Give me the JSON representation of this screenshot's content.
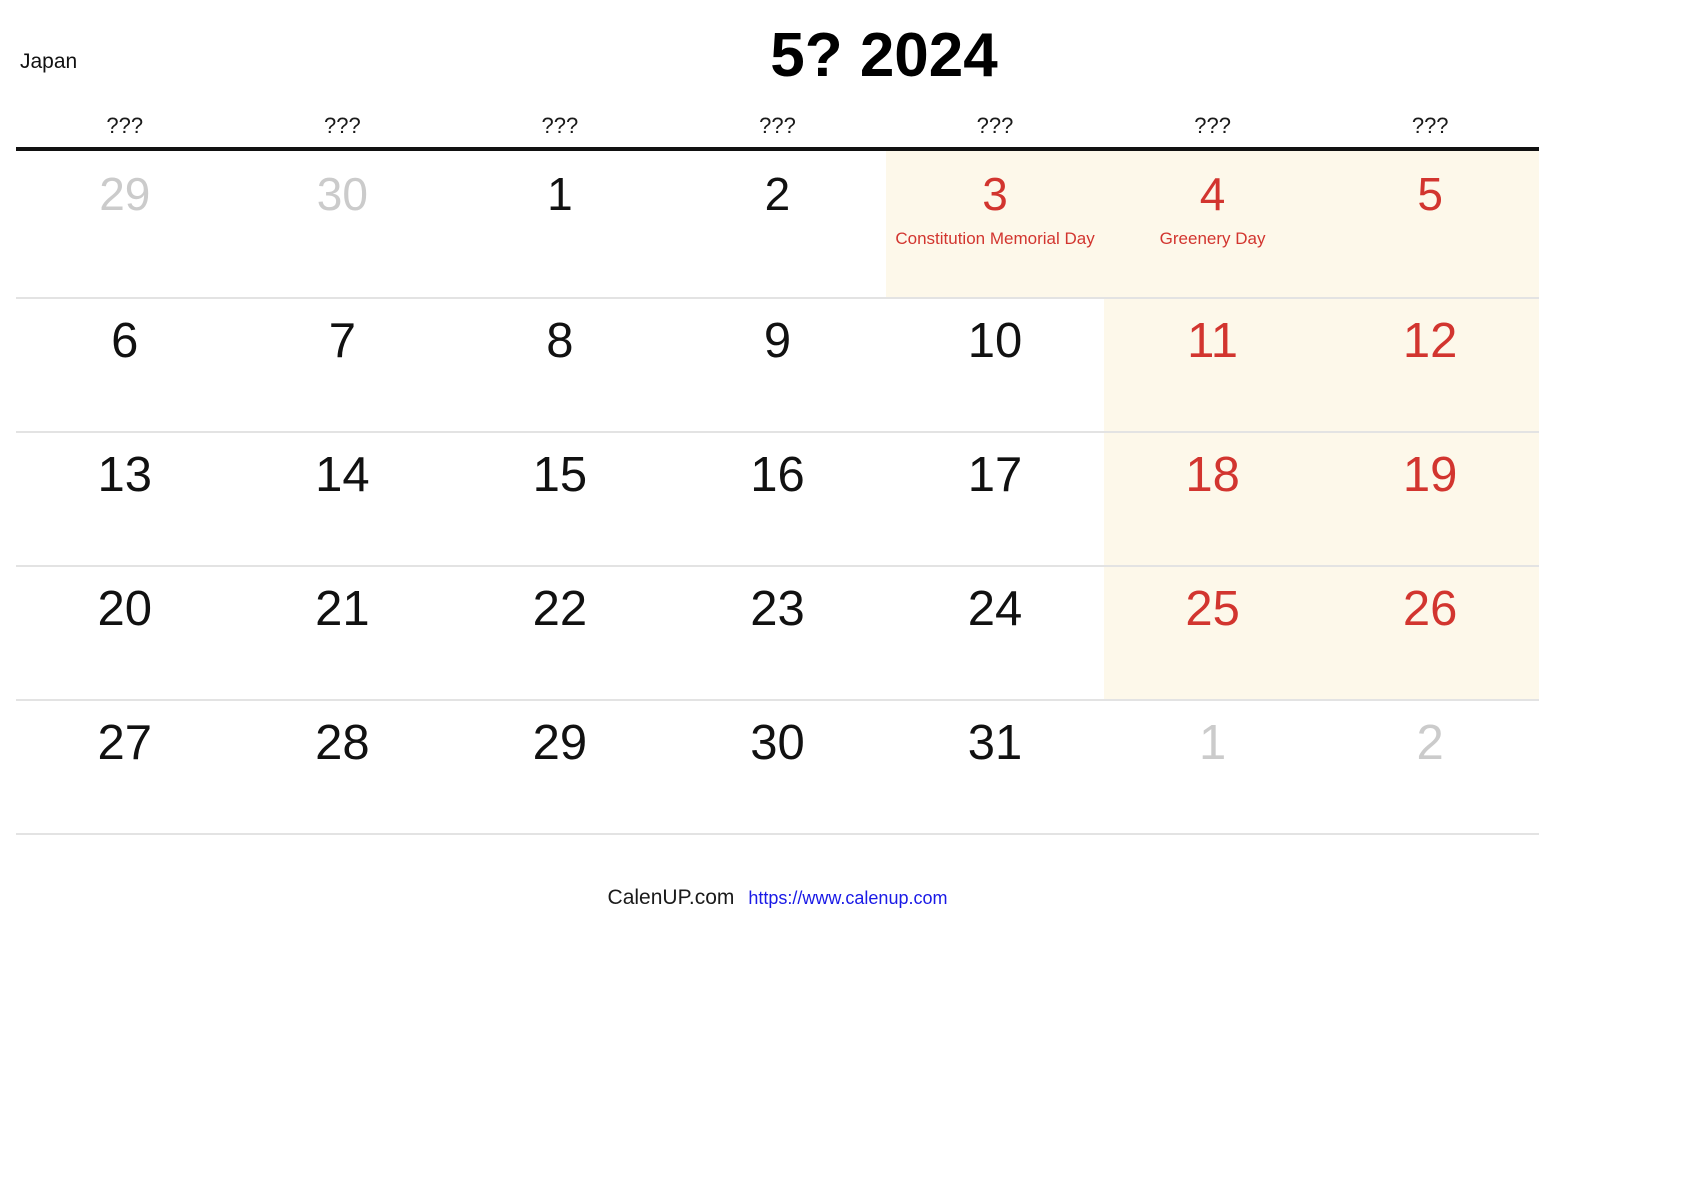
{
  "header": {
    "region_label": "Japan",
    "title": "5? 2024"
  },
  "weekday_headers": [
    "???",
    "???",
    "???",
    "???",
    "???",
    "???",
    "???"
  ],
  "colors": {
    "holiday_red": "#d2352f",
    "weekend_bg": "#fdf8ea",
    "muted_gray": "#cbcbcb",
    "link_blue": "#1919e6",
    "rule_black": "#111111",
    "row_divider": "#e3e3e3"
  },
  "weeks": [
    {
      "days": [
        {
          "num": "29",
          "style": "muted",
          "shaded": false,
          "holiday": ""
        },
        {
          "num": "30",
          "style": "muted",
          "shaded": false,
          "holiday": ""
        },
        {
          "num": "1",
          "style": "normal",
          "shaded": false,
          "holiday": ""
        },
        {
          "num": "2",
          "style": "normal",
          "shaded": false,
          "holiday": ""
        },
        {
          "num": "3",
          "style": "red",
          "shaded": true,
          "holiday": "Constitution Memorial Day"
        },
        {
          "num": "4",
          "style": "red",
          "shaded": true,
          "holiday": "Greenery Day"
        },
        {
          "num": "5",
          "style": "red",
          "shaded": true,
          "holiday": ""
        }
      ]
    },
    {
      "days": [
        {
          "num": "6",
          "style": "normal",
          "shaded": false,
          "holiday": ""
        },
        {
          "num": "7",
          "style": "normal",
          "shaded": false,
          "holiday": ""
        },
        {
          "num": "8",
          "style": "normal",
          "shaded": false,
          "holiday": ""
        },
        {
          "num": "9",
          "style": "normal",
          "shaded": false,
          "holiday": ""
        },
        {
          "num": "10",
          "style": "normal",
          "shaded": false,
          "holiday": ""
        },
        {
          "num": "11",
          "style": "red",
          "shaded": true,
          "holiday": ""
        },
        {
          "num": "12",
          "style": "red",
          "shaded": true,
          "holiday": ""
        }
      ]
    },
    {
      "days": [
        {
          "num": "13",
          "style": "normal",
          "shaded": false,
          "holiday": ""
        },
        {
          "num": "14",
          "style": "normal",
          "shaded": false,
          "holiday": ""
        },
        {
          "num": "15",
          "style": "normal",
          "shaded": false,
          "holiday": ""
        },
        {
          "num": "16",
          "style": "normal",
          "shaded": false,
          "holiday": ""
        },
        {
          "num": "17",
          "style": "normal",
          "shaded": false,
          "holiday": ""
        },
        {
          "num": "18",
          "style": "red",
          "shaded": true,
          "holiday": ""
        },
        {
          "num": "19",
          "style": "red",
          "shaded": true,
          "holiday": ""
        }
      ]
    },
    {
      "days": [
        {
          "num": "20",
          "style": "normal",
          "shaded": false,
          "holiday": ""
        },
        {
          "num": "21",
          "style": "normal",
          "shaded": false,
          "holiday": ""
        },
        {
          "num": "22",
          "style": "normal",
          "shaded": false,
          "holiday": ""
        },
        {
          "num": "23",
          "style": "normal",
          "shaded": false,
          "holiday": ""
        },
        {
          "num": "24",
          "style": "normal",
          "shaded": false,
          "holiday": ""
        },
        {
          "num": "25",
          "style": "red",
          "shaded": true,
          "holiday": ""
        },
        {
          "num": "26",
          "style": "red",
          "shaded": true,
          "holiday": ""
        }
      ]
    },
    {
      "days": [
        {
          "num": "27",
          "style": "normal",
          "shaded": false,
          "holiday": ""
        },
        {
          "num": "28",
          "style": "normal",
          "shaded": false,
          "holiday": ""
        },
        {
          "num": "29",
          "style": "normal",
          "shaded": false,
          "holiday": ""
        },
        {
          "num": "30",
          "style": "normal",
          "shaded": false,
          "holiday": ""
        },
        {
          "num": "31",
          "style": "normal",
          "shaded": false,
          "holiday": ""
        },
        {
          "num": "1",
          "style": "muted",
          "shaded": false,
          "holiday": ""
        },
        {
          "num": "2",
          "style": "muted",
          "shaded": false,
          "holiday": ""
        }
      ]
    }
  ],
  "footer": {
    "brand": "CalenUP.com",
    "url": "https://www.calenup.com"
  }
}
